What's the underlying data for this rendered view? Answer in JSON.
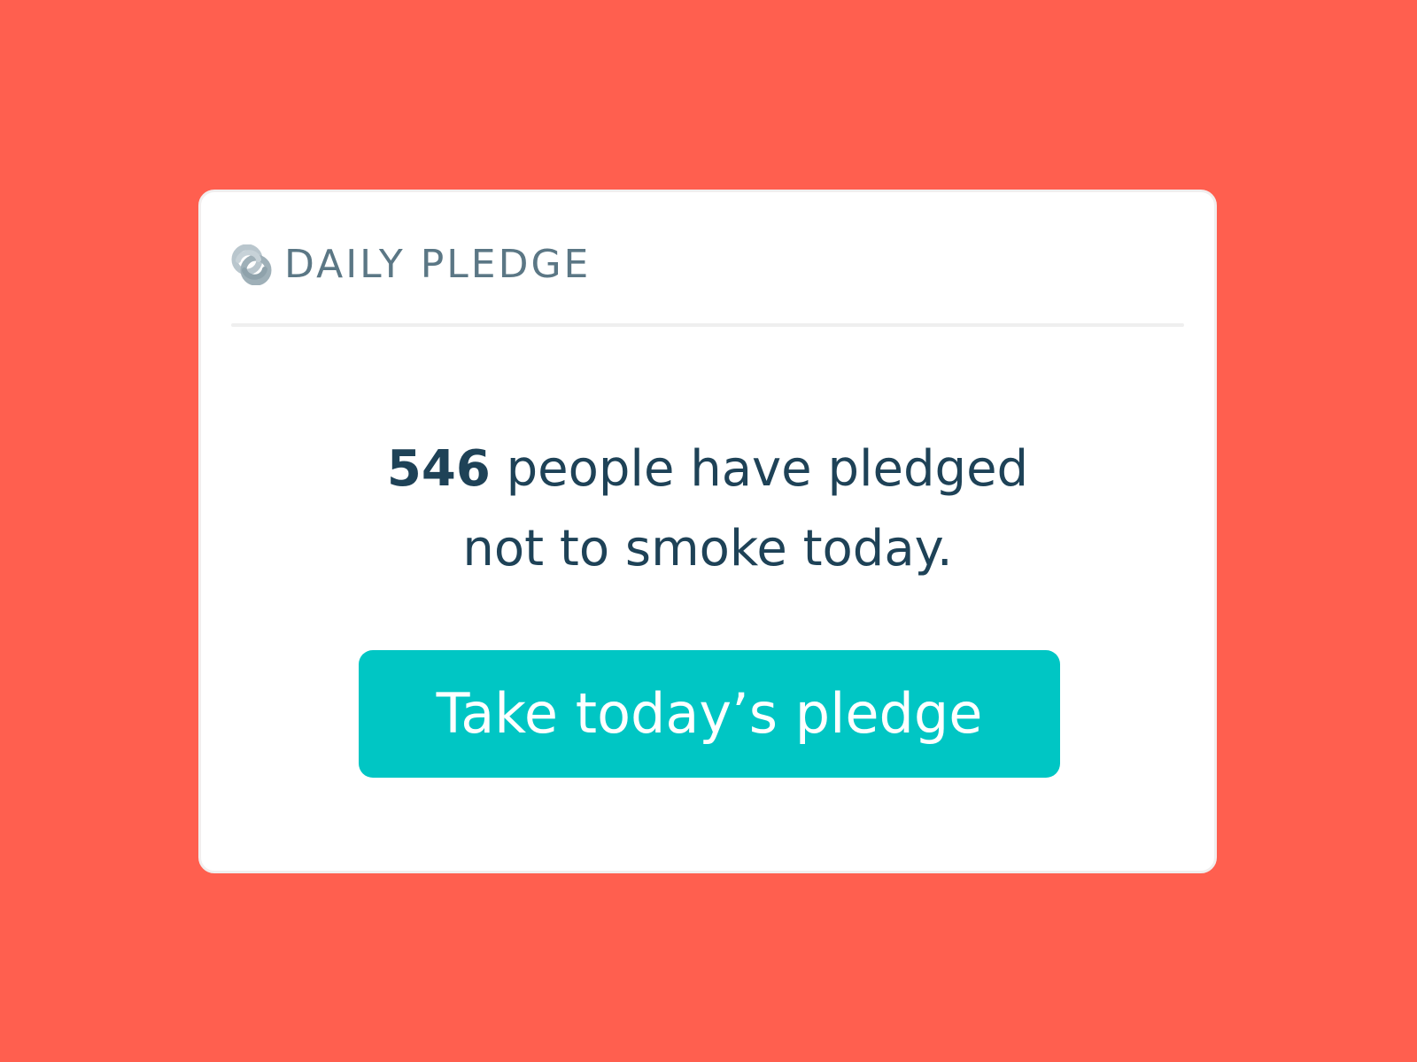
{
  "colors": {
    "background": "#ff5f4f",
    "card": "#ffffff",
    "brand_text": "#5b7785",
    "message_text": "#1e4257",
    "button": "#00c6c4",
    "button_text": "#ffffff"
  },
  "brand": {
    "icon": "daily-pledge-logo-icon",
    "name": "DAILY PLEDGE"
  },
  "pledge": {
    "count": "546",
    "line1_rest": " people have pledged",
    "line2": "not to smoke today."
  },
  "button": {
    "label": "Take today’s pledge"
  }
}
